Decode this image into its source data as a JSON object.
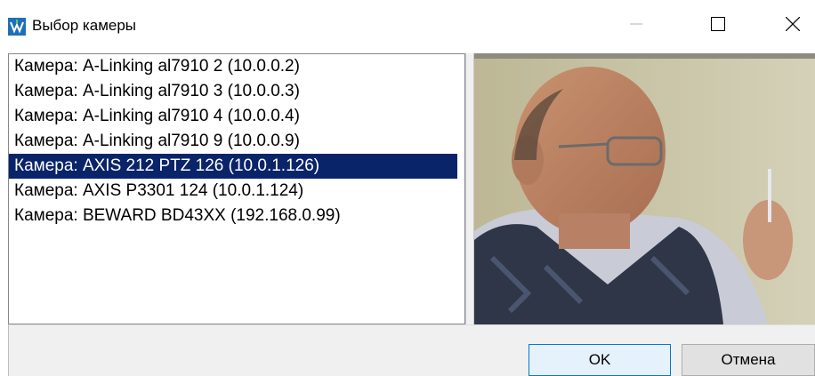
{
  "window": {
    "title": "Выбор камеры",
    "icon": "app-logo-icon",
    "controls": {
      "minimize": "minimize-icon",
      "maximize": "maximize-icon",
      "close": "close-icon"
    }
  },
  "camera_list": {
    "items": [
      {
        "label": "Камера: A-Linking al7910 2 (10.0.0.2)",
        "selected": false
      },
      {
        "label": "Камера: A-Linking al7910 3 (10.0.0.3)",
        "selected": false
      },
      {
        "label": "Камера: A-Linking al7910 4 (10.0.0.4)",
        "selected": false
      },
      {
        "label": "Камера: A-Linking al7910 9 (10.0.0.9)",
        "selected": false
      },
      {
        "label": "Камера: AXIS 212 PTZ 126 (10.0.1.126)",
        "selected": true
      },
      {
        "label": "Камера: AXIS P3301 124 (10.0.1.124)",
        "selected": false
      },
      {
        "label": "Камера: BEWARD BD43XX (192.168.0.99)",
        "selected": false
      }
    ],
    "selection_color": "#0a246a"
  },
  "buttons": {
    "ok_label": "OK",
    "cancel_label": "Отмена"
  }
}
